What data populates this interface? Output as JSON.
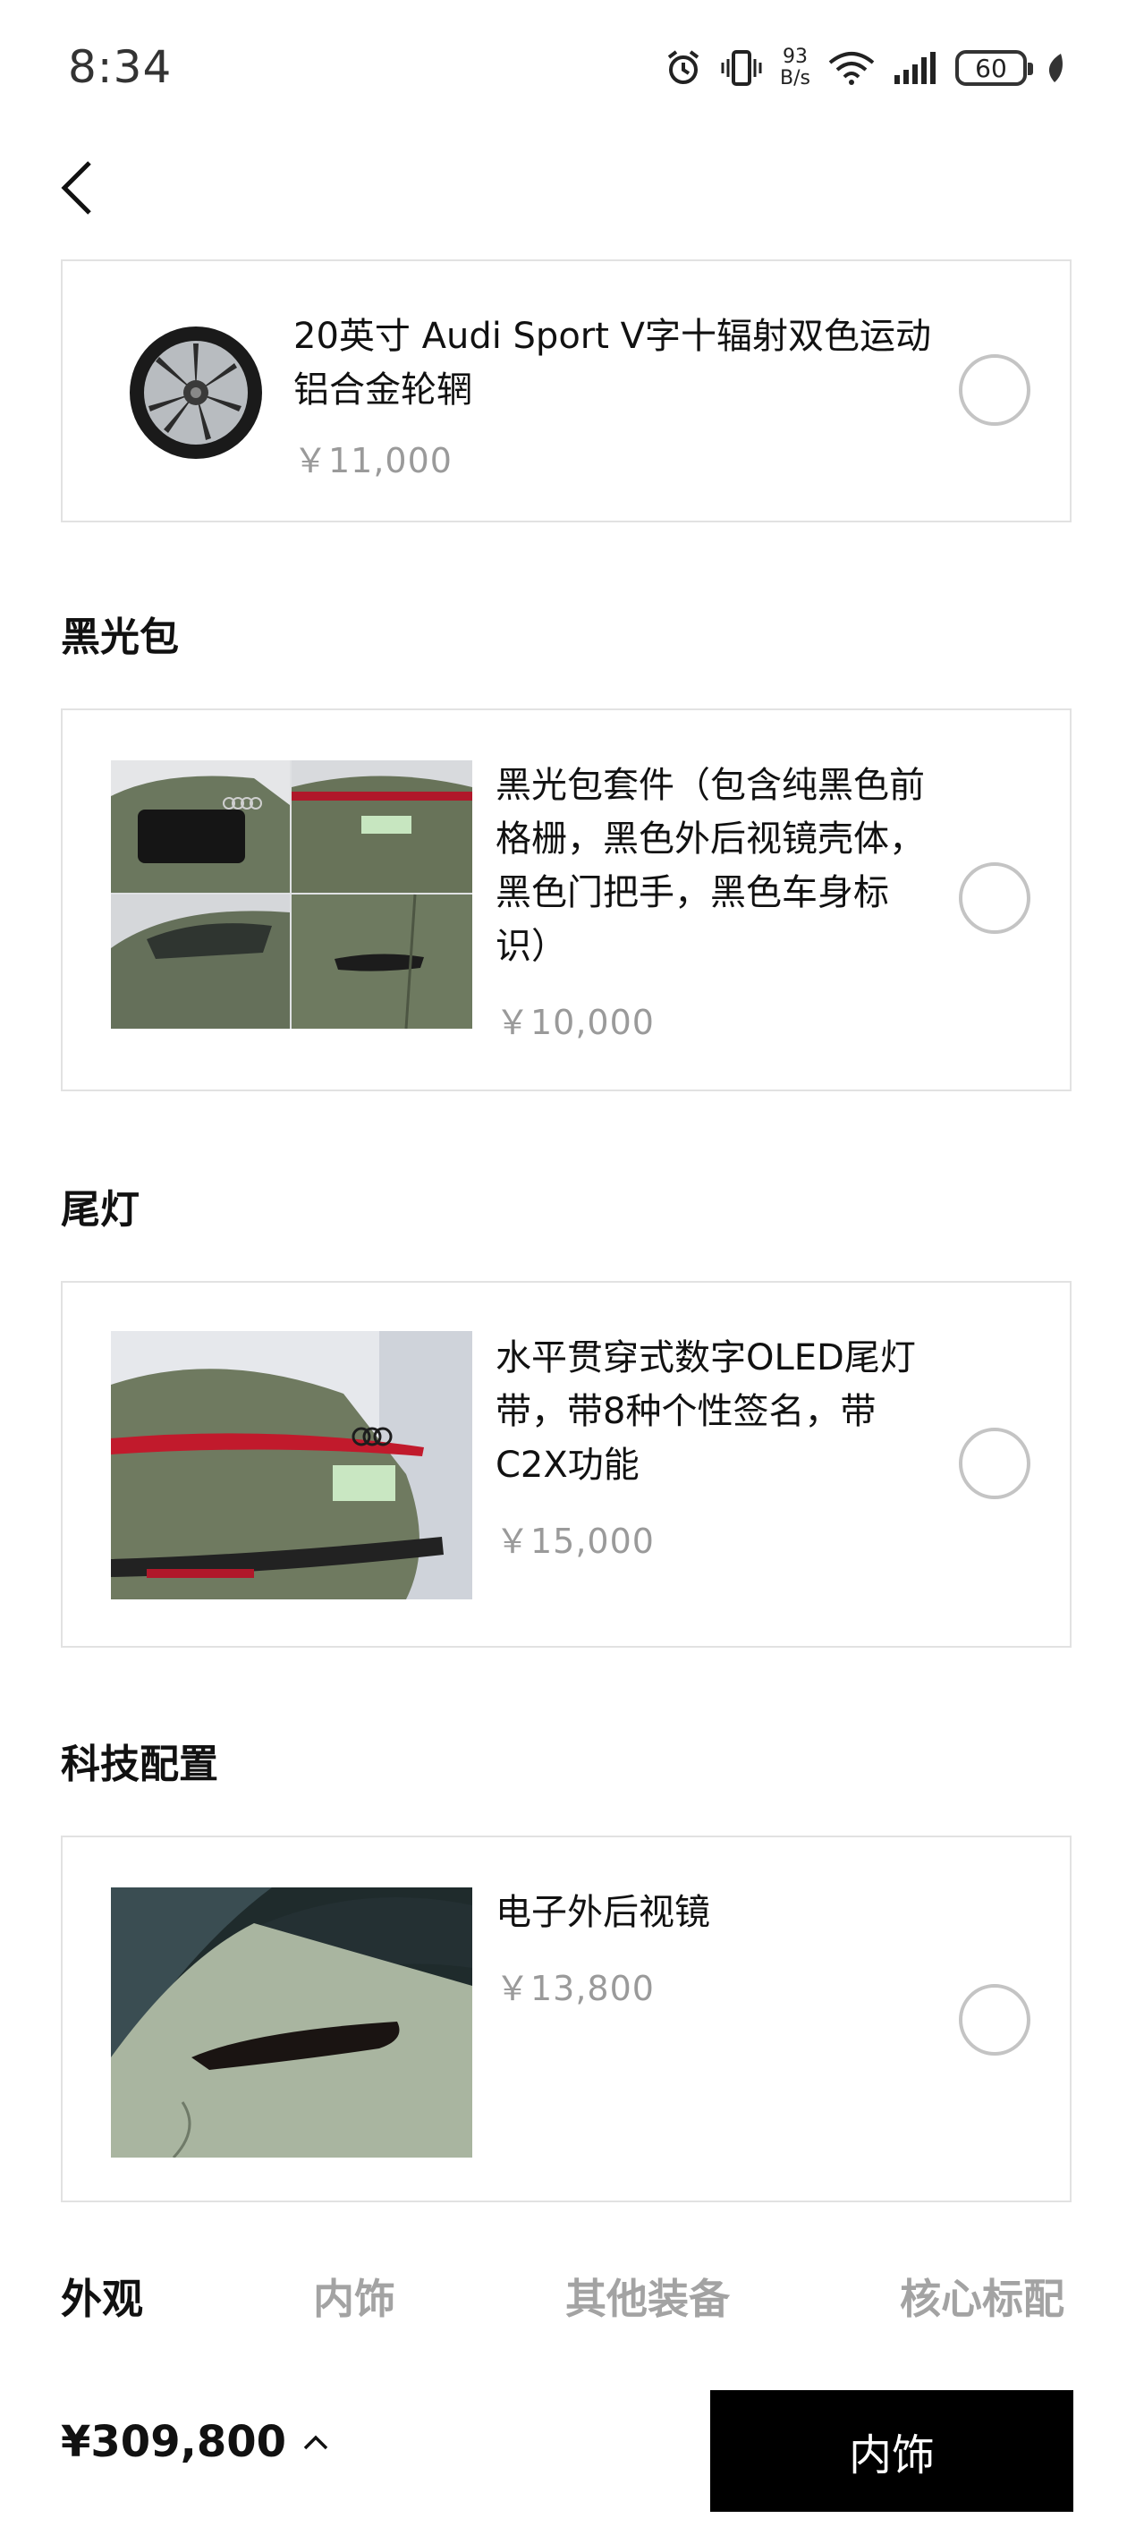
{
  "status_bar": {
    "time": "8:34",
    "net_speed_value": "93",
    "net_speed_unit": "B/s",
    "battery": "60",
    "icons": [
      "alarm-icon",
      "vibrate-icon",
      "wifi-icon",
      "signal-icon",
      "battery-icon",
      "leaf-icon"
    ]
  },
  "nav": {
    "back_icon": "chevron-left-icon"
  },
  "wheel_option": {
    "title": "20英寸 Audi Sport V字十辐射双色运动铝合金轮辋",
    "price": "￥11,000"
  },
  "sections": [
    {
      "title": "黑光包",
      "option": {
        "title": "黑光包套件（包含纯黑色前格栅，黑色外后视镜壳体，黑色门把手，黑色车身标识）",
        "price": "￥10,000"
      }
    },
    {
      "title": "尾灯",
      "option": {
        "title": "水平贯穿式数字OLED尾灯带，带8种个性签名，带C2X功能",
        "price": "￥15,000"
      }
    },
    {
      "title": "科技配置",
      "option": {
        "title": "电子外后视镜",
        "price": "￥13,800"
      }
    }
  ],
  "tabs": [
    {
      "label": "外观",
      "active": true
    },
    {
      "label": "内饰",
      "active": false
    },
    {
      "label": "其他装备",
      "active": false
    },
    {
      "label": "核心标配",
      "active": false
    }
  ],
  "footer": {
    "total_price": "¥309,800",
    "expand_icon": "chevron-up-icon",
    "next_label": "内饰"
  },
  "colors": {
    "car_body": "#6b775e",
    "primary_button": "#000000",
    "muted_text": "#9a9a9a"
  }
}
